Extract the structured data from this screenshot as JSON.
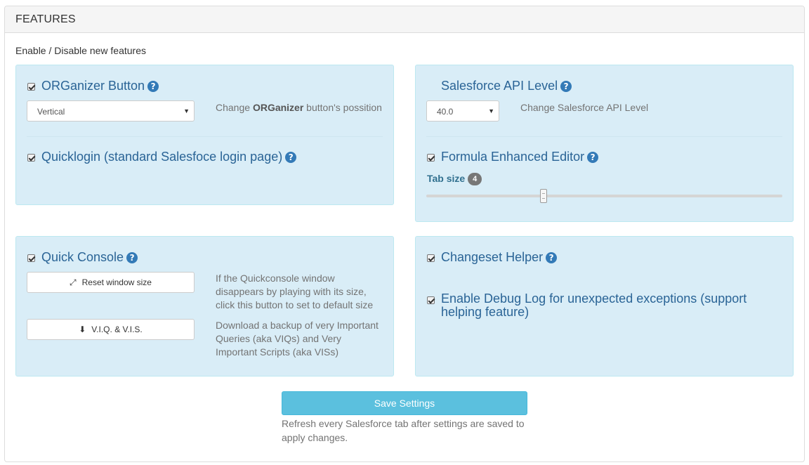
{
  "panel": {
    "title": "FEATURES",
    "intro": "Enable / Disable new features"
  },
  "organizer": {
    "label": "ORGanizer Button",
    "help": "?",
    "position_value": "Vertical",
    "help_prefix": "Change ",
    "help_bold": "ORGanizer",
    "help_suffix": " button's possition"
  },
  "quicklogin": {
    "label": "Quicklogin (standard Salesfoce login page)",
    "help": "?"
  },
  "api": {
    "label": "Salesforce API Level",
    "help": "?",
    "value": "40.0",
    "help_text": "Change Salesforce API Level"
  },
  "formula": {
    "label": "Formula Enhanced Editor",
    "help": "?",
    "tab_size_label": "Tab size",
    "tab_size": "4",
    "slider_fraction": 0.33
  },
  "console": {
    "label": "Quick Console",
    "help": "?",
    "reset_label": "Reset window size",
    "reset_icon": "expand-arrows-icon",
    "reset_help": "If the Quickconsole window disappears by playing with its size, click this button to set to default size",
    "backup_label": "V.I.Q. & V.I.S.",
    "backup_icon": "download-icon",
    "backup_help": "Download a backup of very Important Queries (aka VIQs) and Very Important Scripts (aka VISs)"
  },
  "changeset": {
    "label": "Changeset Helper",
    "help": "?"
  },
  "debug": {
    "label": "Enable Debug Log for unexpected exceptions (support helping feature)"
  },
  "footer": {
    "save_label": "Save Settings",
    "save_help": "Refresh every Salesforce tab after settings are saved to apply changes."
  },
  "colors": {
    "well_bg": "#d9edf7",
    "label": "#2a6496",
    "save_btn": "#5bc0de"
  }
}
